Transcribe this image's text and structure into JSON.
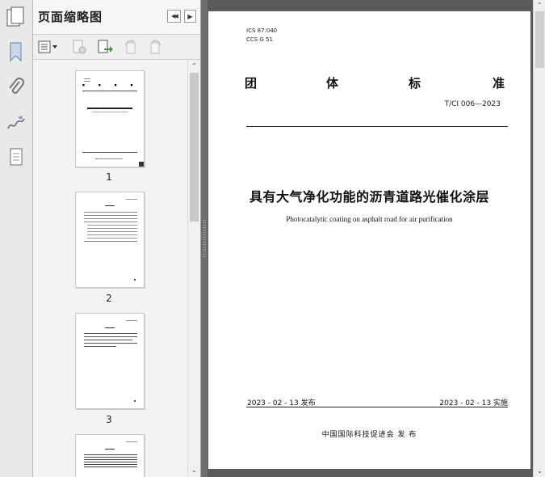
{
  "panel": {
    "title": "页面缩略图",
    "prev_page_glyph": "◀◀",
    "next_page_glyph": "▶"
  },
  "icons": {
    "panel": "page-thumbnails-icon",
    "rail": [
      "bookmark-icon",
      "attachment-icon",
      "signature-icon",
      "layers-icon"
    ],
    "toolbar": [
      "options-menu-icon",
      "delete-page-icon",
      "insert-page-icon",
      "rotate-left-icon",
      "rotate-right-icon"
    ]
  },
  "thumbnails": [
    {
      "label": "1"
    },
    {
      "label": "2"
    },
    {
      "label": "3"
    },
    {
      "label": ""
    }
  ],
  "document": {
    "ics": "ICS  87.040",
    "ccs": "CCS  G 51",
    "standard_type_chars": [
      "团",
      "体",
      "标",
      "准"
    ],
    "code": "T/CI 006—2023",
    "title_cn": "具有大气净化功能的沥青道路光催化涂层",
    "title_en": "Photocatalytic coating on asphalt road for air purification",
    "publish_date": "2023 - 02 - 13 发布",
    "effective_date": "2023 - 02 - 13 实施",
    "publisher": "中国国际科技促进会     发  布"
  },
  "colors": {
    "workspace": "#5a5a5a",
    "panel": "#f3f3f3",
    "rail": "#e9e9e9"
  }
}
